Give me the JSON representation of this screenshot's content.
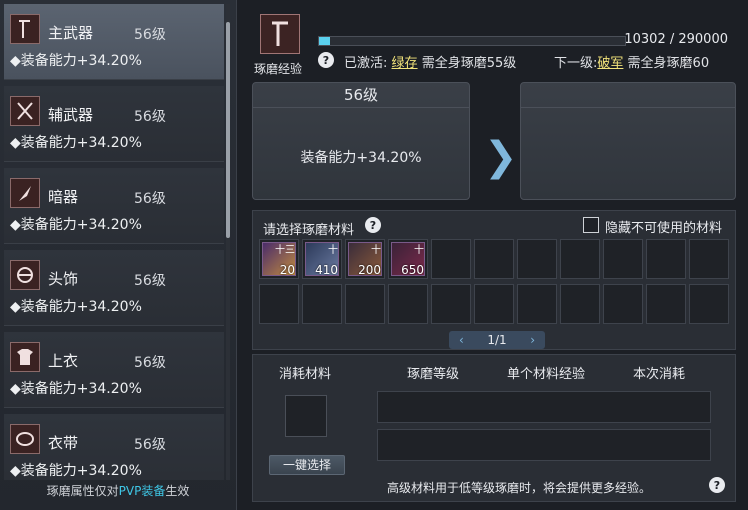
{
  "sidebar": {
    "items": [
      {
        "name": "主武器",
        "level": "56级",
        "bonus": "◆装备能力+34.20%",
        "icon": "weapon-icon",
        "selected": true
      },
      {
        "name": "辅武器",
        "level": "56级",
        "bonus": "◆装备能力+34.20%",
        "icon": "secondary-weapon-icon",
        "selected": false
      },
      {
        "name": "暗器",
        "level": "56级",
        "bonus": "◆装备能力+34.20%",
        "icon": "hidden-weapon-icon",
        "selected": false
      },
      {
        "name": "头饰",
        "level": "56级",
        "bonus": "◆装备能力+34.20%",
        "icon": "headwear-icon",
        "selected": false
      },
      {
        "name": "上衣",
        "level": "56级",
        "bonus": "◆装备能力+34.20%",
        "icon": "top-icon",
        "selected": false
      },
      {
        "name": "衣带",
        "level": "56级",
        "bonus": "◆装备能力+34.20%",
        "icon": "belt-icon",
        "selected": false
      }
    ],
    "footnote_prefix": "琢磨属性仅对",
    "footnote_highlight": "PVP装备",
    "footnote_suffix": "生效"
  },
  "header": {
    "icon_label": "琢磨经验",
    "xp_text": "10302 / 290000",
    "xp_fraction": 0.035,
    "activated_label": "已激活:",
    "activated_link": "绿存",
    "activated_desc": "需全身琢磨55级",
    "next_label": "下一级:",
    "next_link": "破军",
    "next_desc": "需全身琢磨60",
    "help": "?"
  },
  "current": {
    "level": "56级",
    "bonus": "装备能力+34.20%"
  },
  "next": {
    "level": "",
    "bonus": ""
  },
  "materials": {
    "title": "请选择琢磨材料",
    "help": "?",
    "hide_label": "隐藏不可使用的材料",
    "slots": [
      {
        "count": "20",
        "tag": "十三"
      },
      {
        "count": "410",
        "tag": "十"
      },
      {
        "count": "200",
        "tag": "十"
      },
      {
        "count": "650",
        "tag": "十"
      }
    ],
    "page": "1/1"
  },
  "consume": {
    "col1": "消耗材料",
    "col2": "琢磨等级",
    "col3": "单个材料经验",
    "col4": "本次消耗",
    "onekey": "一键选择",
    "note": "高级材料用于低等级琢磨时，将会提供更多经验。",
    "help": "?"
  },
  "colors": {
    "accent": "#5ad0ee",
    "link": "#f2e37a",
    "highlight": "#3fc7e6"
  }
}
